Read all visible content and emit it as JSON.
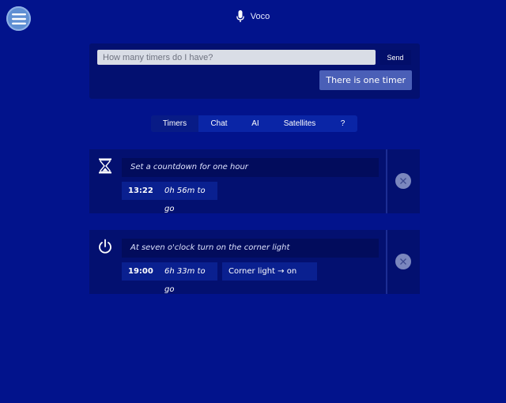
{
  "header": {
    "app_title": "Voco",
    "mic_icon": "microphone-icon",
    "menu_icon": "hamburger-menu-icon"
  },
  "chat": {
    "input_placeholder": "How many timers do I have?",
    "input_value": "",
    "send_label": "Send",
    "reply_text": "There is one timer"
  },
  "tabs": [
    {
      "label": "Timers",
      "active": true
    },
    {
      "label": "Chat",
      "active": false
    },
    {
      "label": "AI",
      "active": false
    },
    {
      "label": "Satellites",
      "active": false
    },
    {
      "label": "?",
      "active": false
    }
  ],
  "timers": [
    {
      "icon": "hourglass-icon",
      "description": "Set a countdown for one hour",
      "clock": "13:22",
      "to_go": "0h 56m to go",
      "action": ""
    },
    {
      "icon": "power-icon",
      "description": "At seven o'clock turn on the corner light",
      "clock": "19:00",
      "to_go": "6h 33m to go",
      "action": "Corner light → on"
    }
  ],
  "colors": {
    "background": "#02138c",
    "panel": "#031070",
    "reply_bubble": "#4a5fb7",
    "menu_button": "#5f8fd3"
  }
}
